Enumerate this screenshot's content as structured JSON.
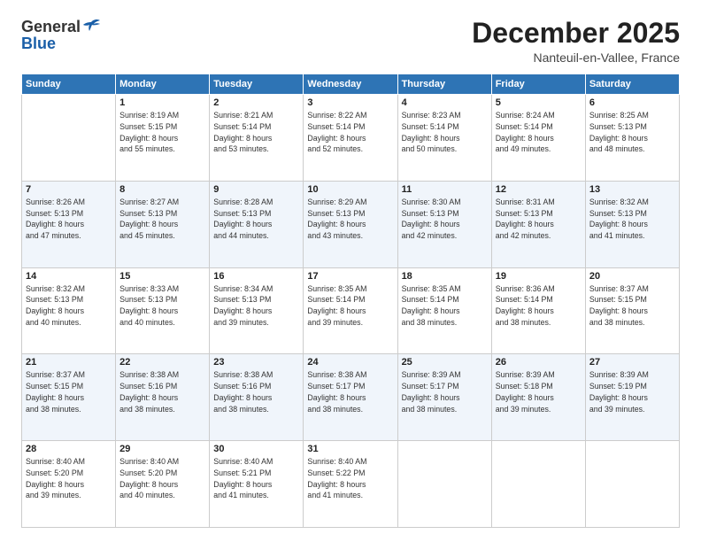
{
  "logo": {
    "line1": "General",
    "line2": "Blue"
  },
  "header": {
    "month": "December 2025",
    "location": "Nanteuil-en-Vallee, France"
  },
  "weekdays": [
    "Sunday",
    "Monday",
    "Tuesday",
    "Wednesday",
    "Thursday",
    "Friday",
    "Saturday"
  ],
  "weeks": [
    [
      {
        "day": "",
        "info": ""
      },
      {
        "day": "1",
        "info": "Sunrise: 8:19 AM\nSunset: 5:15 PM\nDaylight: 8 hours\nand 55 minutes."
      },
      {
        "day": "2",
        "info": "Sunrise: 8:21 AM\nSunset: 5:14 PM\nDaylight: 8 hours\nand 53 minutes."
      },
      {
        "day": "3",
        "info": "Sunrise: 8:22 AM\nSunset: 5:14 PM\nDaylight: 8 hours\nand 52 minutes."
      },
      {
        "day": "4",
        "info": "Sunrise: 8:23 AM\nSunset: 5:14 PM\nDaylight: 8 hours\nand 50 minutes."
      },
      {
        "day": "5",
        "info": "Sunrise: 8:24 AM\nSunset: 5:14 PM\nDaylight: 8 hours\nand 49 minutes."
      },
      {
        "day": "6",
        "info": "Sunrise: 8:25 AM\nSunset: 5:13 PM\nDaylight: 8 hours\nand 48 minutes."
      }
    ],
    [
      {
        "day": "7",
        "info": "Sunrise: 8:26 AM\nSunset: 5:13 PM\nDaylight: 8 hours\nand 47 minutes."
      },
      {
        "day": "8",
        "info": "Sunrise: 8:27 AM\nSunset: 5:13 PM\nDaylight: 8 hours\nand 45 minutes."
      },
      {
        "day": "9",
        "info": "Sunrise: 8:28 AM\nSunset: 5:13 PM\nDaylight: 8 hours\nand 44 minutes."
      },
      {
        "day": "10",
        "info": "Sunrise: 8:29 AM\nSunset: 5:13 PM\nDaylight: 8 hours\nand 43 minutes."
      },
      {
        "day": "11",
        "info": "Sunrise: 8:30 AM\nSunset: 5:13 PM\nDaylight: 8 hours\nand 42 minutes."
      },
      {
        "day": "12",
        "info": "Sunrise: 8:31 AM\nSunset: 5:13 PM\nDaylight: 8 hours\nand 42 minutes."
      },
      {
        "day": "13",
        "info": "Sunrise: 8:32 AM\nSunset: 5:13 PM\nDaylight: 8 hours\nand 41 minutes."
      }
    ],
    [
      {
        "day": "14",
        "info": "Sunrise: 8:32 AM\nSunset: 5:13 PM\nDaylight: 8 hours\nand 40 minutes."
      },
      {
        "day": "15",
        "info": "Sunrise: 8:33 AM\nSunset: 5:13 PM\nDaylight: 8 hours\nand 40 minutes."
      },
      {
        "day": "16",
        "info": "Sunrise: 8:34 AM\nSunset: 5:13 PM\nDaylight: 8 hours\nand 39 minutes."
      },
      {
        "day": "17",
        "info": "Sunrise: 8:35 AM\nSunset: 5:14 PM\nDaylight: 8 hours\nand 39 minutes."
      },
      {
        "day": "18",
        "info": "Sunrise: 8:35 AM\nSunset: 5:14 PM\nDaylight: 8 hours\nand 38 minutes."
      },
      {
        "day": "19",
        "info": "Sunrise: 8:36 AM\nSunset: 5:14 PM\nDaylight: 8 hours\nand 38 minutes."
      },
      {
        "day": "20",
        "info": "Sunrise: 8:37 AM\nSunset: 5:15 PM\nDaylight: 8 hours\nand 38 minutes."
      }
    ],
    [
      {
        "day": "21",
        "info": "Sunrise: 8:37 AM\nSunset: 5:15 PM\nDaylight: 8 hours\nand 38 minutes."
      },
      {
        "day": "22",
        "info": "Sunrise: 8:38 AM\nSunset: 5:16 PM\nDaylight: 8 hours\nand 38 minutes."
      },
      {
        "day": "23",
        "info": "Sunrise: 8:38 AM\nSunset: 5:16 PM\nDaylight: 8 hours\nand 38 minutes."
      },
      {
        "day": "24",
        "info": "Sunrise: 8:38 AM\nSunset: 5:17 PM\nDaylight: 8 hours\nand 38 minutes."
      },
      {
        "day": "25",
        "info": "Sunrise: 8:39 AM\nSunset: 5:17 PM\nDaylight: 8 hours\nand 38 minutes."
      },
      {
        "day": "26",
        "info": "Sunrise: 8:39 AM\nSunset: 5:18 PM\nDaylight: 8 hours\nand 39 minutes."
      },
      {
        "day": "27",
        "info": "Sunrise: 8:39 AM\nSunset: 5:19 PM\nDaylight: 8 hours\nand 39 minutes."
      }
    ],
    [
      {
        "day": "28",
        "info": "Sunrise: 8:40 AM\nSunset: 5:20 PM\nDaylight: 8 hours\nand 39 minutes."
      },
      {
        "day": "29",
        "info": "Sunrise: 8:40 AM\nSunset: 5:20 PM\nDaylight: 8 hours\nand 40 minutes."
      },
      {
        "day": "30",
        "info": "Sunrise: 8:40 AM\nSunset: 5:21 PM\nDaylight: 8 hours\nand 41 minutes."
      },
      {
        "day": "31",
        "info": "Sunrise: 8:40 AM\nSunset: 5:22 PM\nDaylight: 8 hours\nand 41 minutes."
      },
      {
        "day": "",
        "info": ""
      },
      {
        "day": "",
        "info": ""
      },
      {
        "day": "",
        "info": ""
      }
    ]
  ]
}
